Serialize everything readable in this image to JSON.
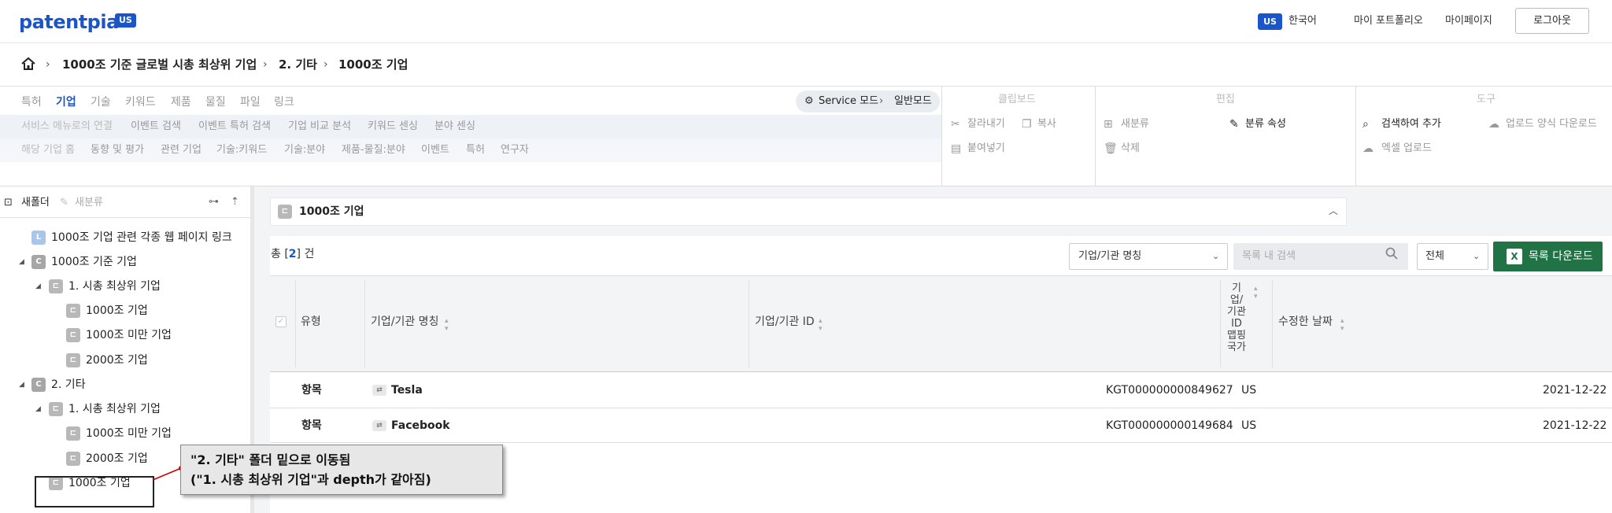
{
  "header": {
    "logo": "patentpia",
    "logo_badge": "US",
    "lang_badge": "US",
    "lang_label": "한국어",
    "nav": [
      "마이 포트폴리오",
      "마이페이지"
    ],
    "logout": "로그아웃"
  },
  "breadcrumb": [
    "1000조 기준 글로벌 시총 최상위 기업",
    "2. 기타",
    "1000조 기업"
  ],
  "ribbon": {
    "tabs": [
      "특허",
      "기업",
      "기술",
      "키워드",
      "제품",
      "물질",
      "파일",
      "링크"
    ],
    "active_tab": "기업",
    "mode_label": "Service 모드",
    "mode_value": "일반모드",
    "row2": [
      "서비스 메뉴로의 연결",
      "이벤트 검색",
      "이벤트 특허 검색",
      "기업 비교 분석",
      "키워드 센싱",
      "분야 센싱"
    ],
    "row3": [
      "해당 기업 홈",
      "동향 및 평가",
      "관련 기업",
      "기술:키워드",
      "기술:분야",
      "제품-물질:분야",
      "이벤트",
      "특허",
      "연구자"
    ],
    "groups": {
      "clipboard": {
        "title": "클립보드",
        "cut": "잘라내기",
        "copy": "복사",
        "paste": "붙여넣기"
      },
      "edit": {
        "title": "편집",
        "new_class": "새분류",
        "class_attr": "분류 속성",
        "delete": "삭제"
      },
      "tools": {
        "title": "도구",
        "search_add": "검색하여 추가",
        "upload_form": "업로드 양식 다운로드",
        "excel_upload": "엑셀 업로드"
      }
    }
  },
  "tree": {
    "toolbar": {
      "new_folder": "새폴더",
      "new_class": "새분류"
    },
    "items": [
      {
        "badge": "L",
        "label": "1000조 기업 관련 각종 웹 페이지 링크"
      },
      {
        "badge": "C",
        "label": "1000조 기준 기업"
      },
      {
        "badge": "⊏",
        "label": "1. 시총 최상위 기업"
      },
      {
        "badge": "⊏",
        "label": "1000조 기업"
      },
      {
        "badge": "⊏",
        "label": "1000조 미만 기업"
      },
      {
        "badge": "⊏",
        "label": "2000조 기업"
      },
      {
        "badge": "C",
        "label": "2. 기타"
      },
      {
        "badge": "⊏",
        "label": "1. 시총 최상위 기업"
      },
      {
        "badge": "⊏",
        "label": "1000조 미만 기업"
      },
      {
        "badge": "⊏",
        "label": "2000조 기업"
      },
      {
        "badge": "⊏",
        "label": "1000조 기업"
      }
    ]
  },
  "main": {
    "folder_title": "1000조 기업",
    "count_prefix": "총 [",
    "count": "2",
    "count_suffix": "] 건",
    "filter_select": "기업/기관 명칭",
    "search_placeholder": "목록 내 검색",
    "scope_select": "전체",
    "download_label": "목록 다운로드",
    "columns": {
      "type": "유형",
      "name": "기업/기관 명칭",
      "id": "기업/기관 ID",
      "country": "기\n업/\n기관\nID\n맵핑\n국가",
      "modified": "수정한 날짜"
    },
    "rows": [
      {
        "type": "항목",
        "name": "Tesla",
        "id": "KGT000000000849627",
        "country": "US",
        "date": "2021-12-22"
      },
      {
        "type": "항목",
        "name": "Facebook",
        "id": "KGT000000000149684",
        "country": "US",
        "date": "2021-12-22"
      }
    ]
  },
  "annotation": {
    "line1": "\"2. 기타\" 폴더 밑으로 이동됨",
    "line2": "(\"1. 시총 최상위 기업\"과 depth가 같아짐)"
  }
}
